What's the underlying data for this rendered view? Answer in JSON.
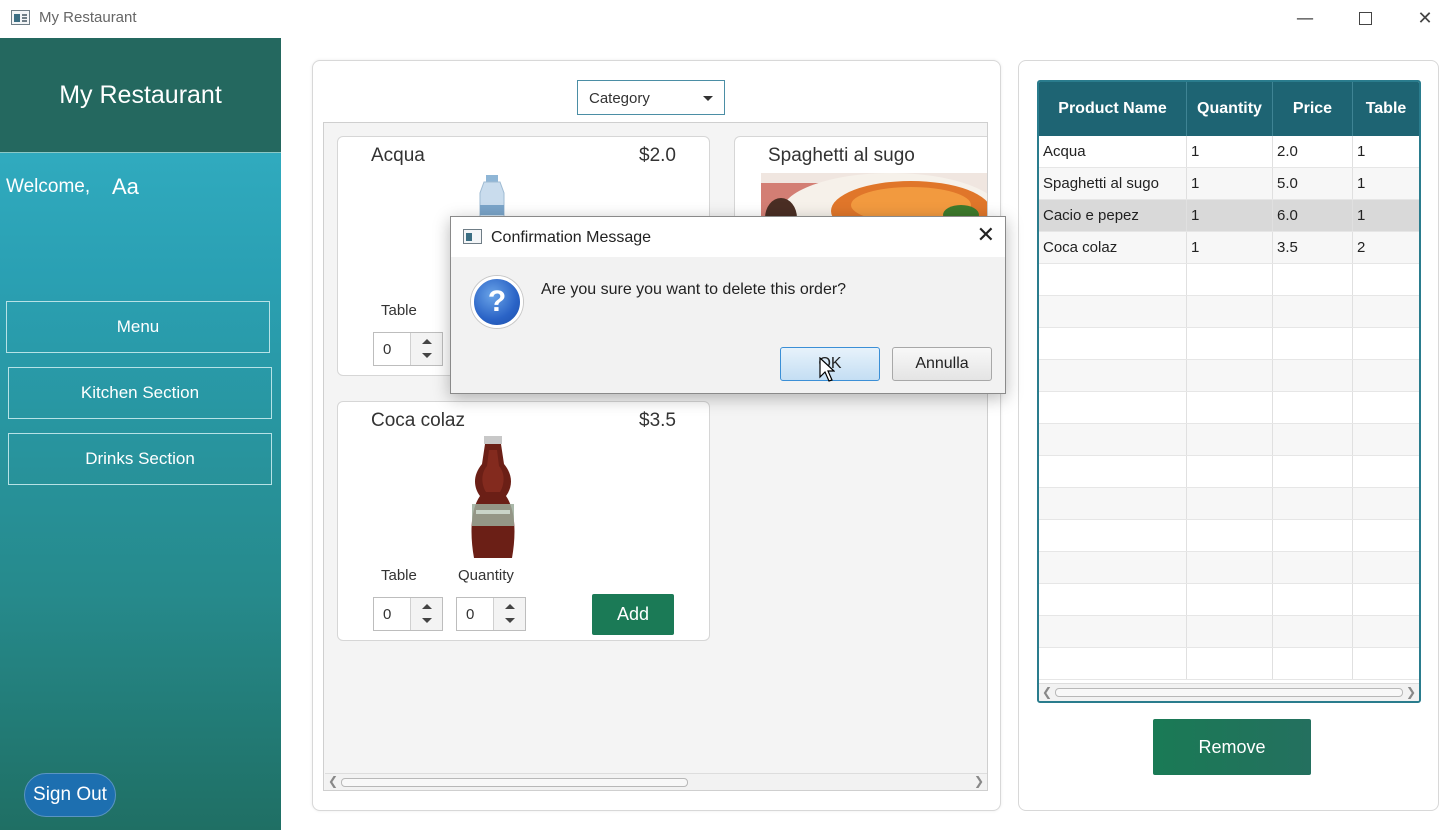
{
  "window": {
    "title": "My Restaurant"
  },
  "sidebar": {
    "title": "My Restaurant",
    "welcome": "Welcome,",
    "username": "Aa",
    "nav": [
      "Menu",
      "Kitchen Section",
      "Drinks Section"
    ],
    "sign_out": "Sign Out"
  },
  "menu_panel": {
    "category_select": {
      "selected": "Category"
    },
    "products": [
      {
        "name": "Acqua",
        "price": "$2.0",
        "table_label": "Table",
        "table_value": "0",
        "image": "water-bottle"
      },
      {
        "name": "Spaghetti al sugo",
        "price": "",
        "image": "spaghetti-plate"
      },
      {
        "name": "Coca colaz",
        "price": "$3.5",
        "table_label": "Table",
        "quantity_label": "Quantity",
        "table_value": "0",
        "quantity_value": "0",
        "add_label": "Add",
        "image": "cola-bottle"
      }
    ]
  },
  "orders": {
    "columns": [
      "Product Name",
      "Quantity",
      "Price",
      "Table"
    ],
    "rows": [
      [
        "Acqua",
        "1",
        "2.0",
        "1"
      ],
      [
        "Spaghetti al sugo",
        "1",
        "5.0",
        "1"
      ],
      [
        "Cacio e pepez",
        "1",
        "6.0",
        "1"
      ],
      [
        "Coca colaz",
        "1",
        "3.5",
        "2"
      ]
    ],
    "selected_row": 2,
    "remove_label": "Remove"
  },
  "dialog": {
    "title": "Confirmation Message",
    "message": "Are you sure you want to delete this order?",
    "icon": "question-icon",
    "ok_label": "OK",
    "cancel_label": "Annulla"
  },
  "colors": {
    "sidebar_header": "#24685f",
    "accent_green": "#1b7a56",
    "table_header": "#1e6473",
    "sign_out": "#1d6fb0"
  }
}
